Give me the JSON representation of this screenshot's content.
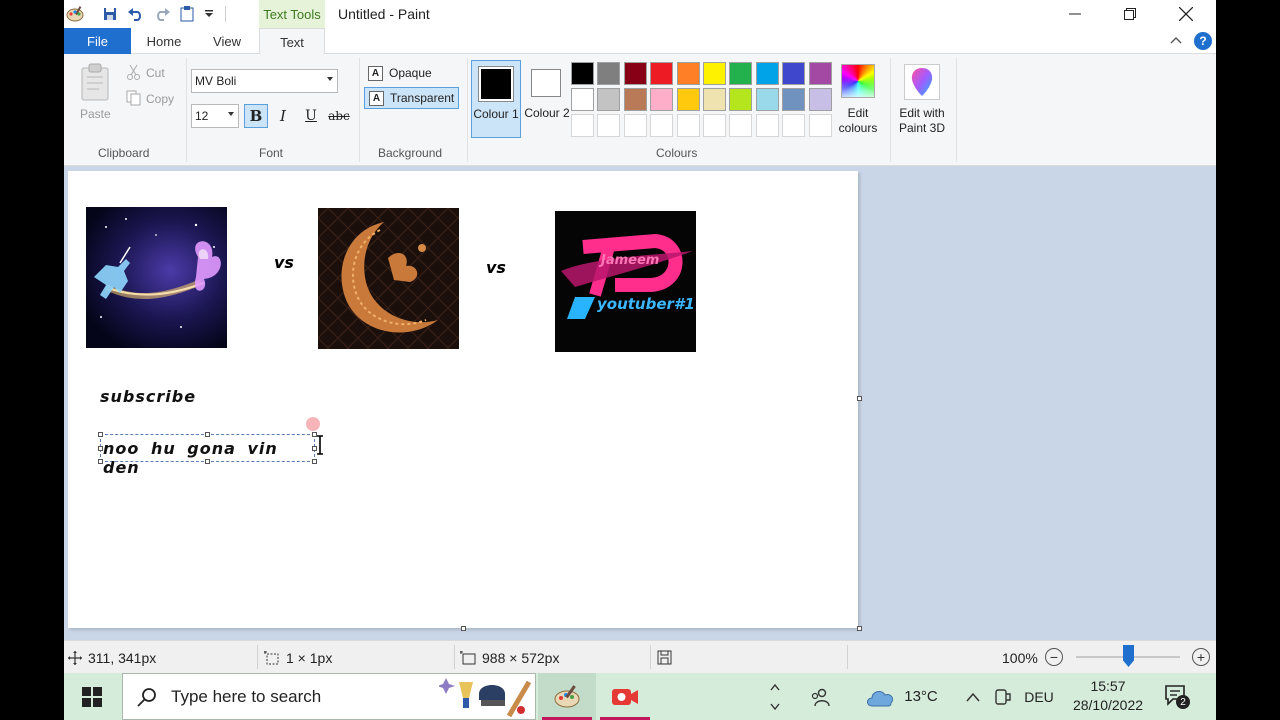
{
  "window": {
    "title": "Untitled - Paint",
    "context_tab": "Text Tools"
  },
  "tabs": {
    "file": "File",
    "home": "Home",
    "view": "View",
    "text": "Text"
  },
  "ribbon": {
    "clipboard": {
      "paste": "Paste",
      "cut": "Cut",
      "copy": "Copy",
      "label": "Clipboard"
    },
    "font": {
      "family": "MV Boli",
      "size": "12",
      "bold": "B",
      "italic": "I",
      "underline": "U",
      "strikethrough": "abc",
      "label": "Font"
    },
    "background": {
      "opaque": "Opaque",
      "transparent": "Transparent",
      "label": "Background"
    },
    "colours": {
      "colour1": "Colour 1",
      "colour2": "Colour 2",
      "edit": "Edit colours",
      "label": "Colours",
      "colour1_value": "#000000",
      "colour2_value": "#ffffff",
      "row1": [
        "#000000",
        "#7f7f7f",
        "#880015",
        "#ed1c24",
        "#ff7f27",
        "#fff200",
        "#22b14c",
        "#00a2e8",
        "#3f48cc",
        "#a349a4"
      ],
      "row2": [
        "#ffffff",
        "#c3c3c3",
        "#b97a57",
        "#ffaec9",
        "#ffc90e",
        "#efe4b0",
        "#b5e61d",
        "#99d9ea",
        "#7092be",
        "#c8bfe7"
      ]
    },
    "paint3d": {
      "label": "Edit with Paint 3D"
    }
  },
  "canvas": {
    "vs1": "vs",
    "vs2": "vs",
    "logo_line1": "Jameem",
    "logo_line2": "youtuber#1",
    "text1": "subscribe",
    "text2": "noo hu gona vin den"
  },
  "statusbar": {
    "cursor_pos": "311, 341px",
    "selection_size": "1 × 1px",
    "image_size": "988 × 572px",
    "zoom": "100%",
    "zoom_out": "−",
    "zoom_in": "+",
    "zoom_fraction": 0.5
  },
  "taskbar": {
    "search_placeholder": "Type here to search",
    "weather": "13°C",
    "language": "DEU",
    "time": "15:57",
    "date": "28/10/2022",
    "notifications": "2"
  }
}
